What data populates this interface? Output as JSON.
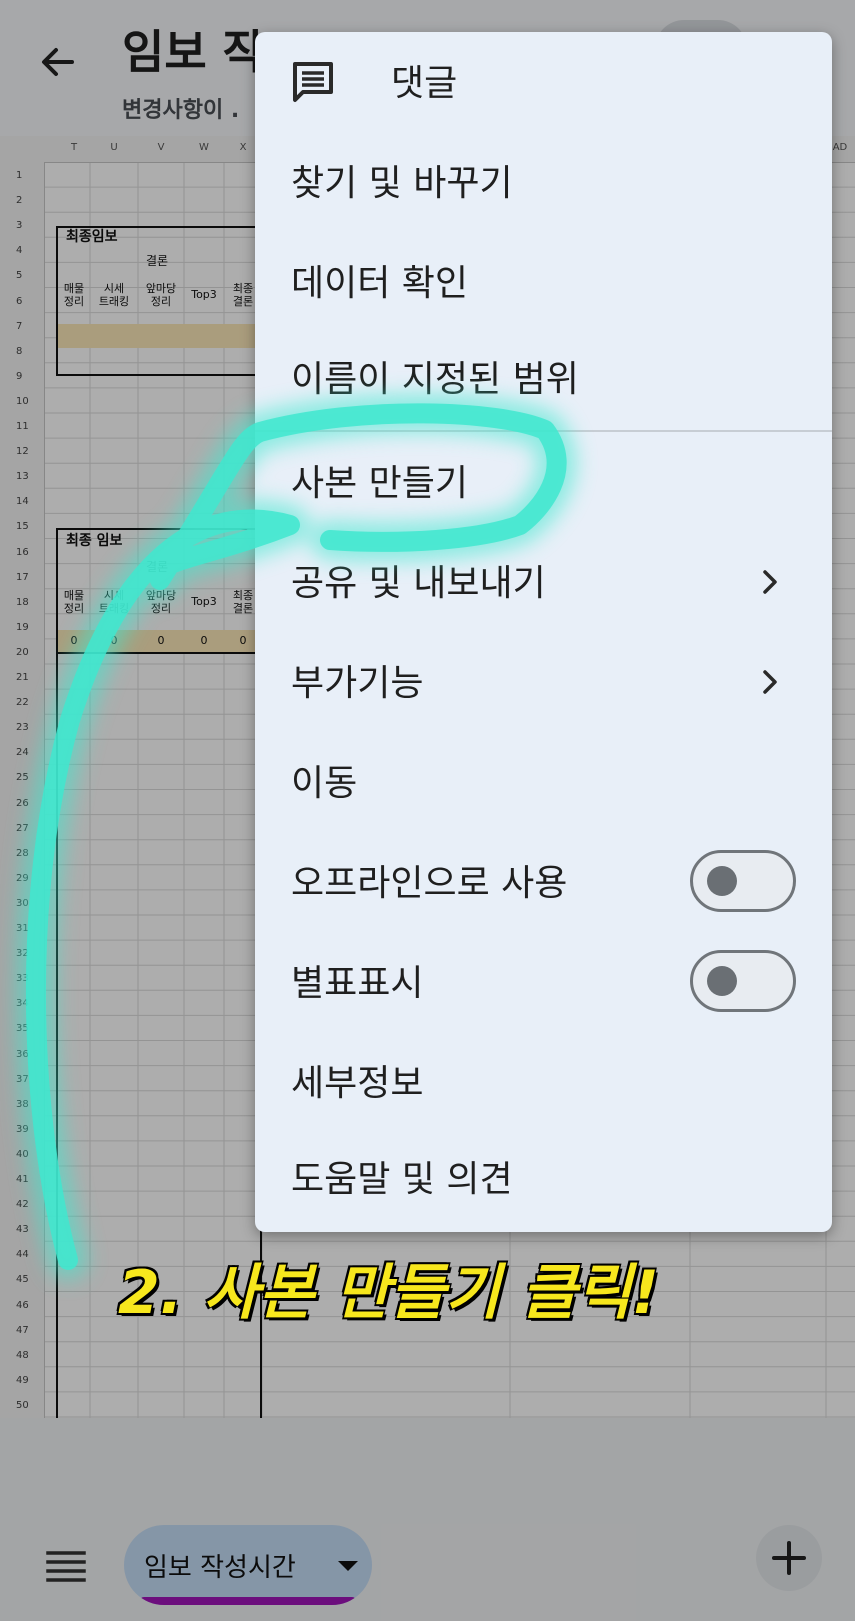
{
  "header": {
    "title": "임보 작",
    "subtitle": "변경사항이 ."
  },
  "sheet": {
    "col_letters": [
      "T",
      "U",
      "V",
      "W",
      "X"
    ],
    "col_letter_far": "AD",
    "row_numbers": [
      "1",
      "2",
      "3",
      "4",
      "5",
      "6",
      "7",
      "8",
      "9",
      "10",
      "11",
      "12",
      "13",
      "14",
      "15",
      "16",
      "17",
      "18",
      "19",
      "20",
      "21",
      "22",
      "23",
      "24",
      "25",
      "26",
      "27",
      "28",
      "29",
      "30",
      "31",
      "32",
      "33",
      "34",
      "35",
      "36",
      "37",
      "38",
      "39",
      "40",
      "41",
      "42",
      "43",
      "44",
      "45",
      "46",
      "47",
      "48",
      "49",
      "50"
    ],
    "table1": {
      "title": "최종임보",
      "group": "결론",
      "headers": [
        "매물\n정리",
        "시세\n트래킹",
        "앞마당\n정리",
        "Top3",
        "최종\n결론"
      ]
    },
    "table2": {
      "title": "최종 임보",
      "group": "결론",
      "headers": [
        "매물\n정리",
        "시세\n트래킹",
        "앞마당\n정리",
        "Top3",
        "최종\n결론"
      ],
      "values": [
        "0",
        "0",
        "0",
        "0",
        "0"
      ]
    }
  },
  "menu": {
    "items": [
      {
        "label": "댓글",
        "icon": "comment-icon"
      },
      {
        "label": "찾기 및 바꾸기"
      },
      {
        "label": "데이터 확인"
      },
      {
        "label": "이름이 지정된 범위"
      },
      {
        "label": "사본 만들기"
      },
      {
        "label": "공유 및 내보내기",
        "has_submenu": true
      },
      {
        "label": "부가기능",
        "has_submenu": true
      },
      {
        "label": "이동"
      },
      {
        "label": "오프라인으로 사용",
        "toggle": false
      },
      {
        "label": "별표표시",
        "toggle": false
      },
      {
        "label": "세부정보"
      },
      {
        "label": "도움말 및 의견"
      }
    ]
  },
  "bottom_bar": {
    "sheet_tab": "임보 작성시간",
    "menu_icon": "list-icon",
    "add_icon": "plus-icon"
  },
  "annotation": {
    "caption": "2. 사본 만들기 클릭!",
    "highlight_color": "#3fe8cf",
    "caption_color": "#f7e71d"
  },
  "colors": {
    "menu_bg": "#e8eff8",
    "accent_tab": "#c4ddf7",
    "tab_underline": "#a015b8"
  }
}
